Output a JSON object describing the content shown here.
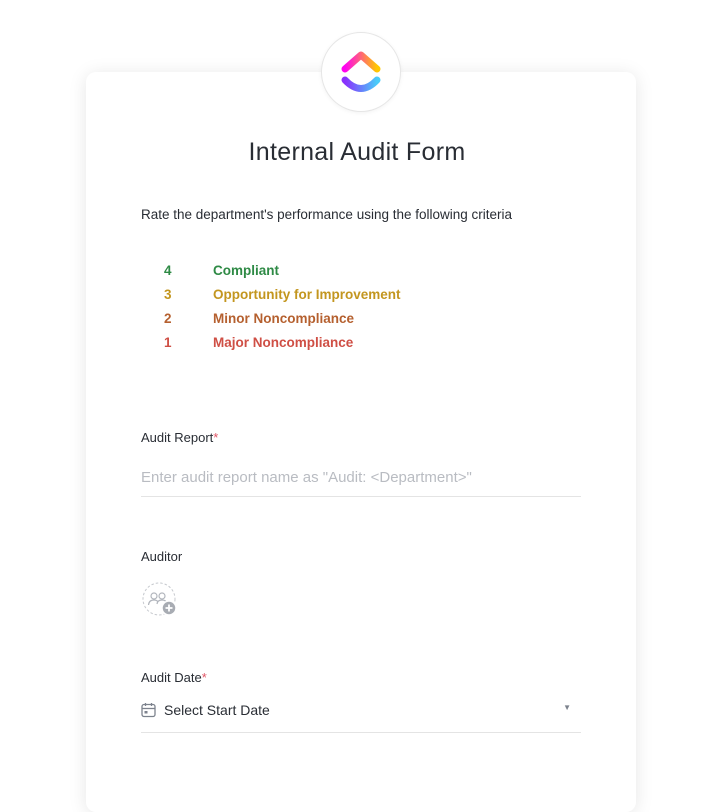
{
  "form": {
    "title": "Internal Audit Form",
    "description": "Rate the department's performance using the following criteria",
    "criteria": [
      {
        "score": "4",
        "label": "Compliant",
        "color": "#2e8a45"
      },
      {
        "score": "3",
        "label": "Opportunity for Improvement",
        "color": "#c3961f"
      },
      {
        "score": "2",
        "label": "Minor Noncompliance",
        "color": "#b5602f"
      },
      {
        "score": "1",
        "label": "Major Noncompliance",
        "color": "#cf4f45"
      }
    ]
  },
  "fields": {
    "audit_report": {
      "label": "Audit Report",
      "required_mark": "*",
      "placeholder": "Enter audit report name as \"Audit: <Department>\""
    },
    "auditor": {
      "label": "Auditor",
      "icon": "add-user-icon"
    },
    "audit_date": {
      "label": "Audit Date",
      "required_mark": "*",
      "value": "Select Start Date",
      "icon": "calendar-icon",
      "caret": "▼"
    }
  },
  "colors": {
    "required": "#e05565",
    "text": "#292d34",
    "placeholder": "#b9bcc2"
  }
}
